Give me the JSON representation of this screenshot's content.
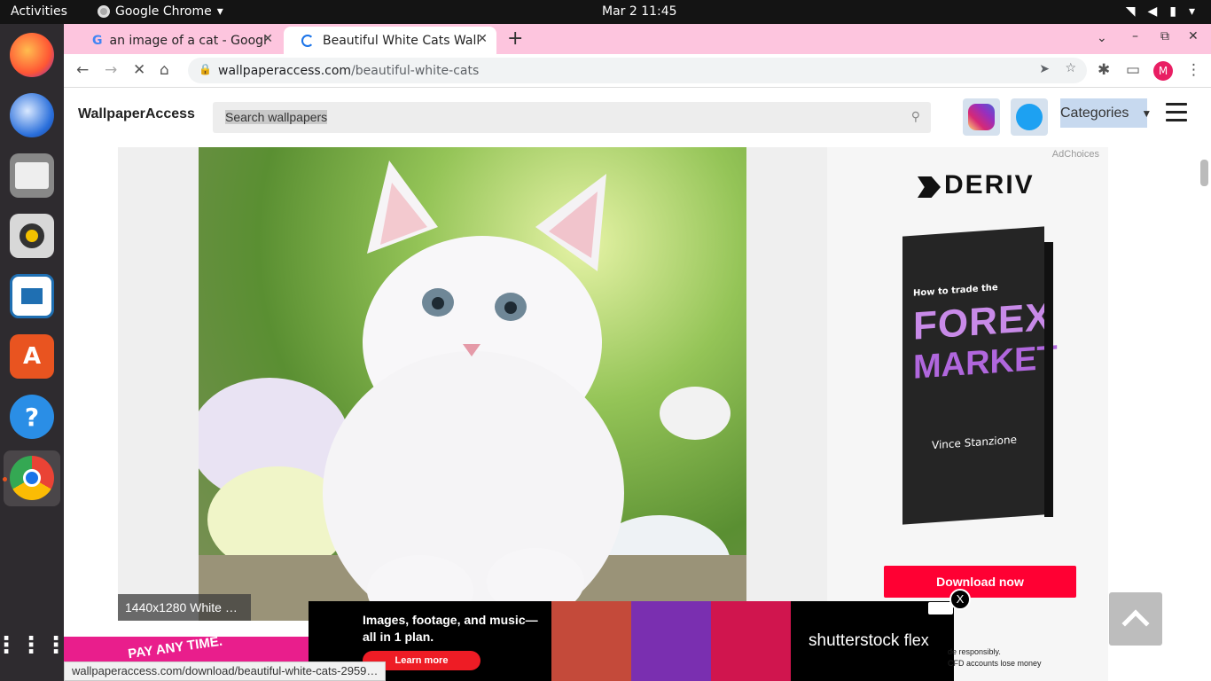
{
  "system": {
    "activities": "Activities",
    "app_name": "Google Chrome",
    "clock": "Mar 2  11:45"
  },
  "dock": {
    "items": [
      "Firefox",
      "Thunderbird",
      "Files",
      "Rhythmbox",
      "LibreOffice Writer",
      "Ubuntu Software",
      "Help",
      "Google Chrome"
    ]
  },
  "browser": {
    "tabs": [
      {
        "title": "an image of a cat - Google"
      },
      {
        "title": "Beautiful White Cats Wall"
      }
    ],
    "url_host": "wallpaperaccess.com",
    "url_path": "/beautiful-white-cats",
    "profile_initial": "M"
  },
  "site": {
    "logo": "WallpaperAccess",
    "search_placeholder": "Search wallpapers",
    "categories_label": "Categories",
    "image_dims": "1440x1280 White …"
  },
  "ad": {
    "choices": "AdChoices",
    "brand": "DERIV",
    "book_line1": "How to trade the",
    "book_line2": "FOREX",
    "book_line3": "MARKET",
    "book_author": "Vince Stanzione",
    "cta": "Download now"
  },
  "banner": {
    "headline": "Images, footage, and music—all in 1 plan.",
    "cta": "Learn more",
    "brand": "shutterstock",
    "brand_suffix": "flex",
    "close": "X",
    "risk_line1": "de responsibly.",
    "risk_line2": "CFD accounts lose money"
  },
  "left_ad": {
    "text": "PAY ANY      TIME."
  },
  "status_url": "wallpaperaccess.com/download/beautiful-white-cats-2959…",
  "colors": {
    "tabstrip": "#fdc5de",
    "cta_red": "#ff0033",
    "chrome_blue": "#1a73e8"
  }
}
